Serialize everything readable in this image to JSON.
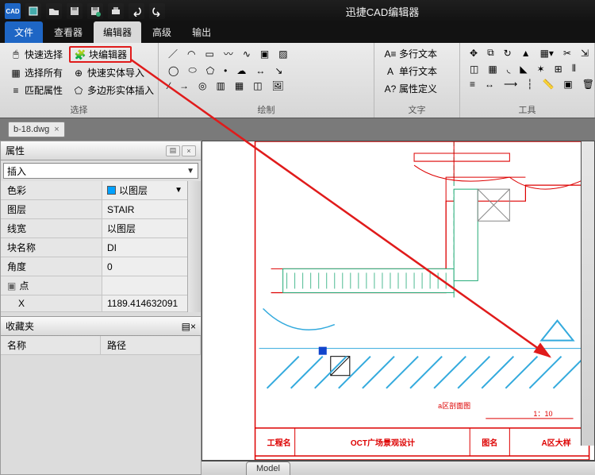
{
  "app": {
    "title": "迅捷CAD编辑器"
  },
  "qat_icons": [
    "cad-logo",
    "new-file",
    "open-file",
    "save-file",
    "save-as",
    "print",
    "undo",
    "redo"
  ],
  "tabs": {
    "file": "文件",
    "viewer": "查看器",
    "editor": "编辑器",
    "advanced": "高级",
    "output": "输出"
  },
  "ribbon": {
    "select": {
      "label": "选择",
      "quick_select": "快速选择",
      "block_editor": "块编辑器",
      "select_all": "选择所有",
      "quick_entity_import": "快速实体导入",
      "match_props": "匹配属性",
      "polygon_entity_insert": "多边形实体插入"
    },
    "draw": {
      "label": "绘制"
    },
    "text": {
      "label": "文字",
      "mtext": "多行文本",
      "stext": "单行文本",
      "attdef": "属性定义"
    },
    "tools": {
      "label": "工具"
    }
  },
  "doc": {
    "name": "b-18.dwg"
  },
  "panel": {
    "props_title": "属性",
    "insert_combo": "插入",
    "rows": {
      "color_k": "色彩",
      "color_v": "以图层",
      "layer_k": "图层",
      "layer_v": "STAIR",
      "lw_k": "线宽",
      "lw_v": "以图层",
      "block_k": "块名称",
      "block_v": "DI",
      "angle_k": "角度",
      "angle_v": "0",
      "point_k": "点",
      "x_k": "X",
      "x_v": "1189.414632091"
    },
    "fav_title": "收藏夹",
    "fav_name": "名称",
    "fav_path": "路径"
  },
  "titleblock": {
    "proj_label": "工程名",
    "proj_value": "OCT广场景观设计",
    "draw_label": "图名",
    "draw_value": "A区大样",
    "section": "a区剖面图",
    "scale": "1：10"
  },
  "model_tab": "Model"
}
